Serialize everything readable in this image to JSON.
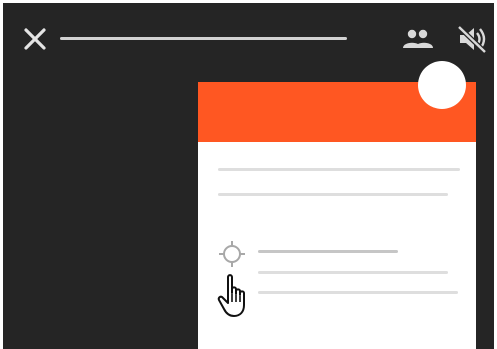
{
  "window": {
    "title": "",
    "close_icon": "close-icon",
    "people_icon": "people-icon",
    "mute_icon": "volume-off-icon"
  },
  "card": {
    "accent_color": "#ff5722",
    "fab_icon": "fab-circle",
    "target_icon": "crosshair-target-icon",
    "cursor_icon": "pointer-hand-cursor-icon"
  },
  "colors": {
    "background": "#252525",
    "accent": "#ff5722",
    "card": "#ffffff"
  }
}
